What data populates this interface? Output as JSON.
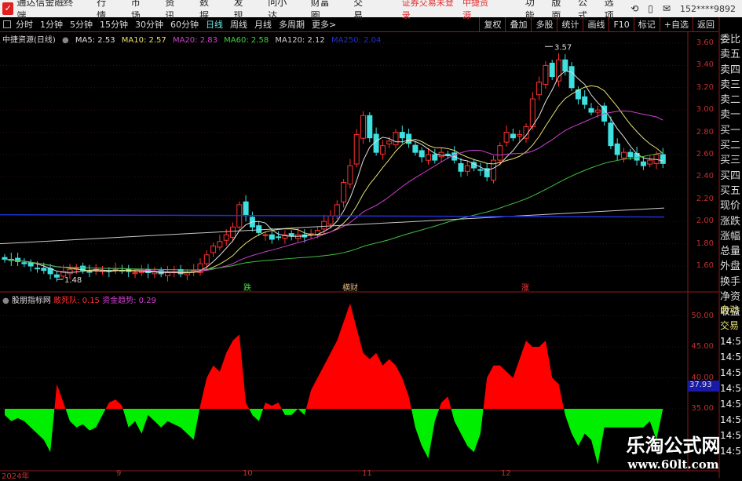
{
  "menubar": {
    "app_title": "通达信金融终端",
    "items": [
      "行情",
      "市场",
      "资讯",
      "数据",
      "发现",
      "问小达",
      "财富圈",
      "交易"
    ],
    "warning": "证券交易未登录",
    "stock": "中捷资源",
    "right_items": [
      "功能",
      "版面",
      "公式",
      "选项"
    ],
    "account": "152****9892"
  },
  "toolbar": {
    "periods": [
      "分时",
      "1分钟",
      "5分钟",
      "15分钟",
      "30分钟",
      "60分钟",
      "日线",
      "周线",
      "月线",
      "多周期",
      "更多>"
    ],
    "active": "日线",
    "right_buttons": [
      "复权",
      "叠加",
      "多股",
      "统计",
      "画线",
      "F10",
      "标记",
      "+自选",
      "返回"
    ]
  },
  "info": {
    "title": "中捷资源(日线)",
    "ma": [
      {
        "label": "MA5: 2.53",
        "color": "#e0e0e0"
      },
      {
        "label": "MA10: 2.57",
        "color": "#e8e070"
      },
      {
        "label": "MA20: 2.83",
        "color": "#d040d0"
      },
      {
        "label": "MA60: 2.58",
        "color": "#40d040"
      },
      {
        "label": "MA120: 2.12",
        "color": "#d0d0d0"
      },
      {
        "label": "MA250: 2.04",
        "color": "#2030d0"
      }
    ]
  },
  "colors": {
    "up": "#ff3030",
    "down": "#40e0e0",
    "hist_up": "#ff0000",
    "hist_down": "#00ee00",
    "axis": "#8b1a1a"
  },
  "price_axis": [
    "3.60",
    "3.40",
    "3.20",
    "3.00",
    "2.80",
    "2.60",
    "2.40",
    "2.20",
    "2.00",
    "1.80",
    "1.60"
  ],
  "right_panel": [
    "委比",
    "卖五",
    "卖四",
    "卖三",
    "卖二",
    "卖一",
    "买一",
    "买二",
    "买三",
    "买四",
    "买五",
    "现价",
    "涨跌",
    "涨幅",
    "总量",
    "外盘",
    "换手",
    "净资",
    "收益"
  ],
  "right_panel2": [
    "自动",
    "交易",
    "14:56",
    "14:56",
    "14:56",
    "14:56",
    "14:56",
    "14:56",
    "14:56",
    "14:5"
  ],
  "annotations": {
    "high": "3.57",
    "low": "1.48"
  },
  "signals": [
    {
      "label": "跌",
      "color": "#40e040"
    },
    {
      "label": "横财",
      "color": "#e0b080"
    },
    {
      "label": "涨",
      "color": "#ff4040"
    }
  ],
  "indicator": {
    "name": "股朋指标网",
    "s1": "敢死队: 0.15",
    "s2": "资金趋势: 0.29",
    "axis": [
      "50.00",
      "45.00",
      "40.00",
      "35.00"
    ],
    "current": "37.93"
  },
  "date_axis": [
    "2024年",
    "9",
    "10",
    "11",
    "12"
  ],
  "watermark": {
    "line1": "乐淘公式网",
    "line2": "www.60lt.com"
  },
  "chart_data": {
    "type": "candlestick",
    "ylim": [
      1.45,
      3.65
    ],
    "close": [
      1.66,
      1.65,
      1.64,
      1.62,
      1.6,
      1.58,
      1.56,
      1.53,
      1.5,
      1.55,
      1.57,
      1.58,
      1.56,
      1.55,
      1.57,
      1.56,
      1.55,
      1.57,
      1.56,
      1.55,
      1.54,
      1.55,
      1.54,
      1.55,
      1.53,
      1.54,
      1.55,
      1.53,
      1.54,
      1.56,
      1.62,
      1.7,
      1.78,
      1.82,
      1.88,
      1.95,
      2.15,
      2.05,
      1.95,
      1.9,
      1.88,
      1.84,
      1.86,
      1.88,
      1.87,
      1.88,
      1.86,
      1.89,
      1.92,
      2.0,
      2.05,
      2.15,
      2.35,
      2.5,
      2.78,
      2.95,
      2.75,
      2.62,
      2.68,
      2.72,
      2.8,
      2.75,
      2.7,
      2.62,
      2.58,
      2.6,
      2.55,
      2.62,
      2.6,
      2.55,
      2.45,
      2.5,
      2.48,
      2.46,
      2.4,
      2.55,
      2.68,
      2.8,
      2.75,
      2.78,
      2.85,
      3.1,
      3.25,
      3.4,
      3.3,
      3.45,
      3.35,
      3.2,
      3.1,
      3.05,
      2.98,
      3.0,
      2.9,
      2.68,
      2.6,
      2.62,
      2.58,
      2.55,
      2.5,
      2.55,
      2.6,
      2.52
    ],
    "ma120": [
      1.8,
      2.12
    ],
    "ma250": [
      2.06,
      2.04
    ],
    "indicator_values": [
      34,
      33,
      33.5,
      33,
      32,
      31,
      30,
      28,
      39,
      36,
      33,
      32,
      32.5,
      31.5,
      32,
      34,
      36,
      36.5,
      35.5,
      32,
      33,
      31,
      34,
      33,
      32,
      33,
      32.5,
      32,
      31,
      30,
      35.5,
      40,
      42,
      41,
      44,
      46,
      47,
      36,
      34,
      33,
      36,
      35.5,
      36,
      34,
      34,
      35,
      34,
      38,
      40,
      42,
      44,
      46,
      49,
      52,
      48,
      44,
      43,
      44,
      42,
      43,
      42,
      40,
      37,
      32,
      29,
      27,
      33,
      36,
      37,
      33,
      31,
      29,
      28,
      31,
      40,
      42,
      42,
      41,
      40,
      43,
      46,
      45,
      45,
      46,
      40,
      39,
      34,
      31,
      29,
      31,
      30,
      26,
      32,
      32,
      32,
      32,
      32,
      32,
      32,
      33,
      30,
      35
    ],
    "indicator_baseline": 35
  }
}
